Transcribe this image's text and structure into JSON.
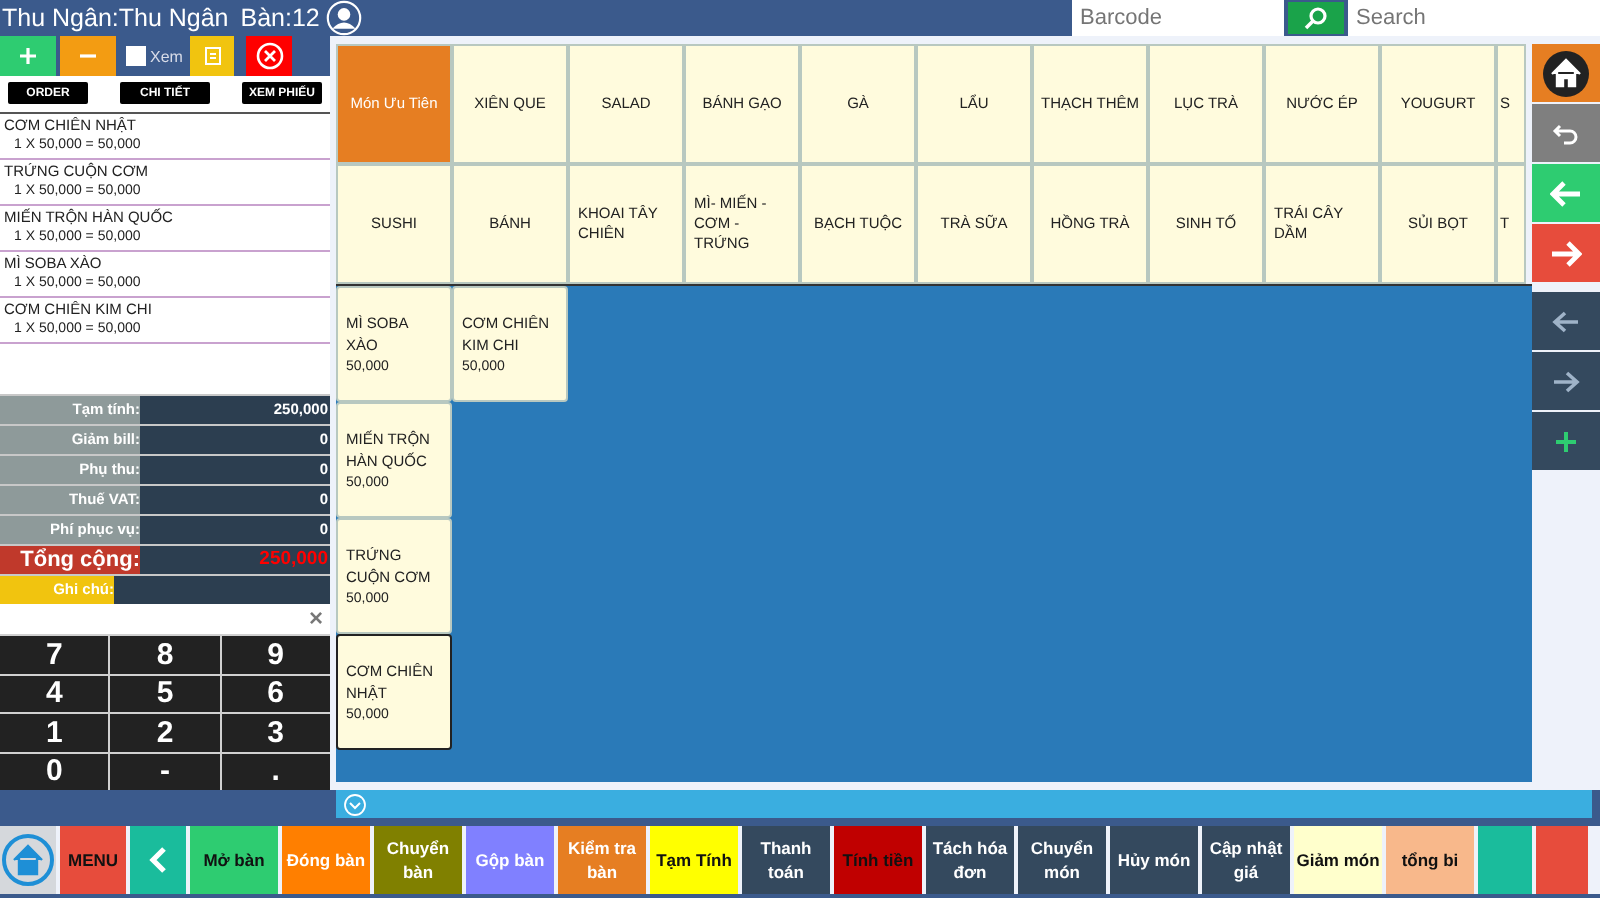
{
  "header": {
    "cashier": "Thu Ngân:Thu Ngân",
    "table": "Bàn:12",
    "barcode": {
      "placeholder": "Barcode"
    },
    "search": {
      "placeholder": "Search"
    }
  },
  "order_toolbar": {
    "view_checkbox": {
      "label": "Xem",
      "checked": false
    }
  },
  "order_tabs": [
    "ORDER",
    "CHI TIẾT",
    "XEM PHIẾU"
  ],
  "order_items": [
    {
      "name": "CƠM CHIÊN NHẬT",
      "line": "1  X  50,000  =  50,000"
    },
    {
      "name": "TRỨNG CUỘN CƠM",
      "line": "1  X  50,000  =  50,000"
    },
    {
      "name": "MIẾN TRỘN HÀN  QUỐC",
      "line": "1  X  50,000  =  50,000"
    },
    {
      "name": "MÌ SOBA XÀO",
      "line": "1  X  50,000  =  50,000"
    },
    {
      "name": "CƠM CHIÊN KIM CHI",
      "line": "1  X  50,000  =  50,000"
    }
  ],
  "totals": [
    {
      "kind": "normal",
      "label": "Tạm tính:",
      "value": "250,000"
    },
    {
      "kind": "normal",
      "label": "Giảm bill:",
      "value": "0"
    },
    {
      "kind": "normal",
      "label": "Phụ thu:",
      "value": "0"
    },
    {
      "kind": "normal",
      "label": "Thuế VAT:",
      "value": "0"
    },
    {
      "kind": "normal",
      "label": "Phí phục vụ:",
      "value": "0"
    },
    {
      "kind": "total",
      "label": "Tổng cộng:",
      "value": "250,000"
    },
    {
      "kind": "note",
      "label": "Ghi chú:"
    }
  ],
  "keypad": {
    "clear": "×",
    "keys": [
      "7",
      "8",
      "9",
      "4",
      "5",
      "6",
      "1",
      "2",
      "3",
      "0",
      "-",
      "."
    ]
  },
  "categories": [
    {
      "label": "Món Ưu Tiên",
      "selected": true
    },
    {
      "label": "XIÊN QUE",
      "selected": false
    },
    {
      "label": "SALAD",
      "selected": false
    },
    {
      "label": "BÁNH GẠO",
      "selected": false
    },
    {
      "label": "GÀ",
      "selected": false
    },
    {
      "label": "LẨU",
      "selected": false
    },
    {
      "label": "THẠCH THÊM",
      "selected": false
    },
    {
      "label": "LỤC TRÀ",
      "selected": false
    },
    {
      "label": "NƯỚC ÉP",
      "selected": false
    },
    {
      "label": "YOUGURT",
      "selected": false
    },
    {
      "label": "S",
      "selected": false
    },
    {
      "label": "SUSHI",
      "selected": false
    },
    {
      "label": "BÁNH",
      "selected": false
    },
    {
      "label": "KHOAI TÂY CHIÊN",
      "selected": false
    },
    {
      "label": "MÌ- MIẾN - CƠM -TRỨNG",
      "selected": false
    },
    {
      "label": "BẠCH TUỘC",
      "selected": false
    },
    {
      "label": "TRÀ SỮA",
      "selected": false
    },
    {
      "label": "HỒNG TRÀ",
      "selected": false
    },
    {
      "label": "SINH TỐ",
      "selected": false
    },
    {
      "label": "TRÁI CÂY DẦM",
      "selected": false
    },
    {
      "label": "SỦI BỌT",
      "selected": false
    },
    {
      "label": "T",
      "selected": false
    }
  ],
  "menu_items": [
    {
      "name": "MÌ SOBA XÀO",
      "price": "50,000",
      "selected": false
    },
    {
      "name": "MIẾN TRỘN HÀN  QUỐC",
      "price": "50,000",
      "selected": false
    },
    {
      "name": "TRỨNG CUỘN CƠM",
      "price": "50,000",
      "selected": false
    },
    {
      "name": "CƠM CHIÊN NHẬT",
      "price": "50,000",
      "selected": true
    },
    {
      "name": "CƠM CHIÊN KIM CHI",
      "price": "50,000",
      "selected": false
    }
  ],
  "bottom_toolbar": [
    {
      "kind": "home",
      "color": "#d5d8dc"
    },
    {
      "kind": "text",
      "label": "MENU",
      "color": "#e74c3c",
      "dark_text": true
    },
    {
      "kind": "back",
      "color": "#1abc9c"
    },
    {
      "kind": "text",
      "label": "Mở bàn",
      "color": "#2ecc71",
      "dark_text": true
    },
    {
      "kind": "text",
      "label": "Đóng bàn",
      "color": "#ff7f00",
      "dark_text": false
    },
    {
      "kind": "text",
      "label": "Chuyển bàn",
      "color": "#808000",
      "dark_text": false
    },
    {
      "kind": "text",
      "label": "Gộp bàn",
      "color": "#8080ff",
      "dark_text": false
    },
    {
      "kind": "text",
      "label": "Kiểm tra bàn",
      "color": "#e67e22",
      "dark_text": false
    },
    {
      "kind": "text",
      "label": "Tạm Tính",
      "color": "#ffff00",
      "dark_text": true
    },
    {
      "kind": "text",
      "label": "Thanh toán",
      "color": "#34495e",
      "dark_text": false
    },
    {
      "kind": "text",
      "label": "Tính tiền",
      "color": "#c00000",
      "dark_text": true
    },
    {
      "kind": "text",
      "label": "Tách hóa đơn",
      "color": "#34495e",
      "dark_text": false
    },
    {
      "kind": "text",
      "label": "Chuyển món",
      "color": "#34495e",
      "dark_text": false
    },
    {
      "kind": "text",
      "label": "Hủy món",
      "color": "#34495e",
      "dark_text": false
    },
    {
      "kind": "text",
      "label": "Cập nhật giá",
      "color": "#34495e",
      "dark_text": false
    },
    {
      "kind": "text",
      "label": "Giảm món",
      "color": "#ffffcc",
      "dark_text": true
    },
    {
      "kind": "text",
      "label": "tổng bi",
      "color": "#f8b88b",
      "dark_text": true
    },
    {
      "kind": "blank",
      "color": "#1abc9c"
    },
    {
      "kind": "blank",
      "color": "#e74c3c"
    }
  ]
}
